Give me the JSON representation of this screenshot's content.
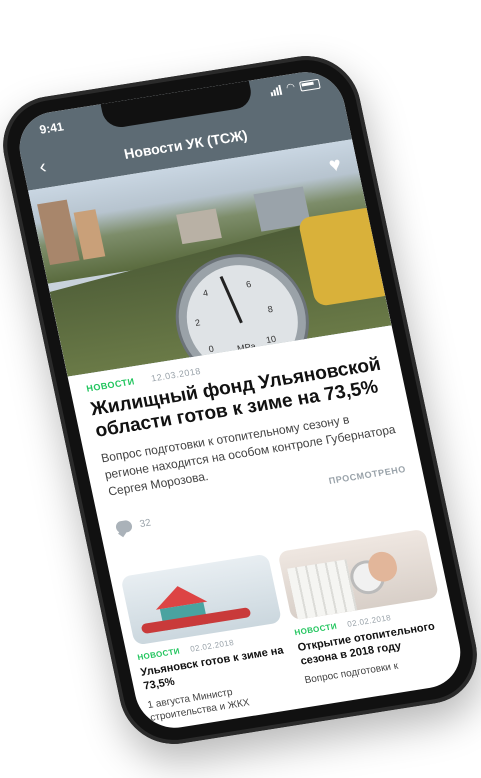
{
  "status_bar": {
    "time": "9:41"
  },
  "header": {
    "title": "Новости УК (ТСЖ)",
    "back_icon": "chevron-left-icon",
    "favorite_icon": "heart-icon"
  },
  "hero": {
    "gauge_numbers": [
      "0",
      "2",
      "4",
      "6",
      "8",
      "10"
    ],
    "gauge_unit": "MPa"
  },
  "article": {
    "category": "НОВОСТИ",
    "date": "12.03.2018",
    "title": "Жилищный фонд Ульяновской области готов к зиме на 73,5%",
    "lead": "Вопрос подготовки к отопительному сезону в регионе находится на особом контроле Губернатора Сергея Морозова.",
    "viewed_label": "ПРОСМОТРЕНО",
    "comments_count": "32"
  },
  "cards": [
    {
      "category": "НОВОСТИ",
      "date": "02.02.2018",
      "title": "Ульяновск готов к зиме на 73,5%",
      "text": "1 августа Министр строительства и ЖКХ"
    },
    {
      "category": "НОВОСТИ",
      "date": "02.02.2018",
      "title": "Открытие отопительного сезона в 2018 году",
      "text": "Вопрос подготовки к"
    }
  ],
  "colors": {
    "header": "#5d6b74",
    "accent": "#22c55e",
    "muted": "#9aa3aa"
  }
}
